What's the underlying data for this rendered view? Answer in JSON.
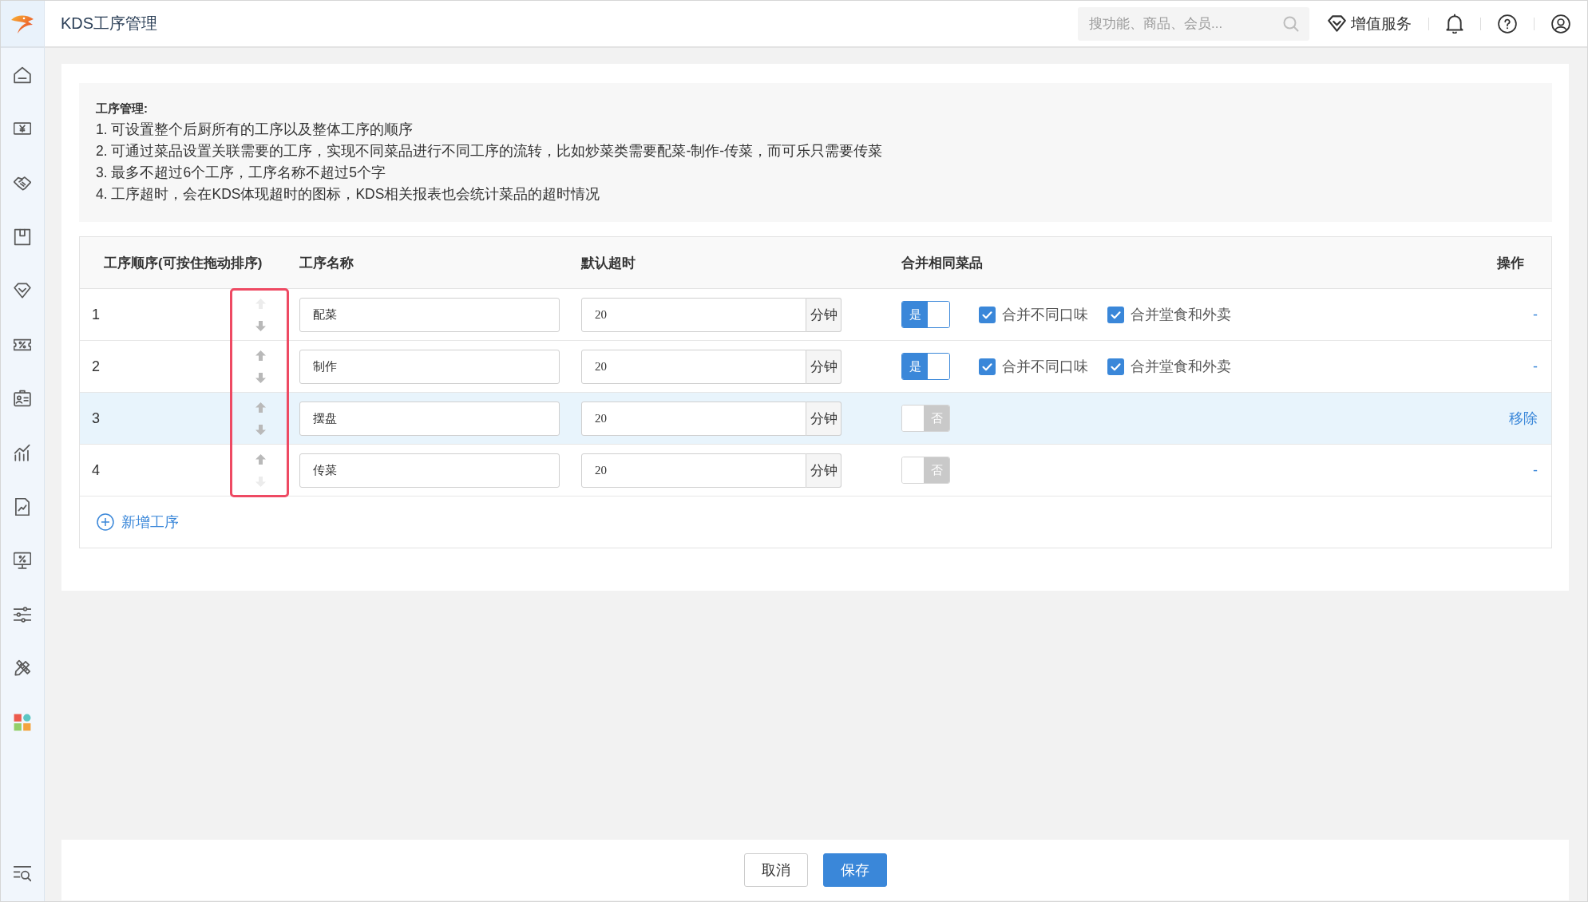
{
  "app": {
    "title": "KDS工序管理"
  },
  "header": {
    "search": {
      "placeholder": "搜功能、商品、会员..."
    },
    "services_label": "增值服务"
  },
  "notes": {
    "title": "工序管理:",
    "items": [
      "1. 可设置整个后厨所有的工序以及整体工序的顺序",
      "2. 可通过菜品设置关联需要的工序，实现不同菜品进行不同工序的流转，比如炒菜类需要配菜-制作-传菜，而可乐只需要传菜",
      "3. 最多不超过6个工序，工序名称不超过5个字",
      "4. 工序超时，会在KDS体现超时的图标，KDS相关报表也会统计菜品的超时情况"
    ]
  },
  "table": {
    "columns": [
      "工序顺序(可按住拖动排序)",
      "工序名称",
      "默认超时",
      "合并相同菜品",
      "操作"
    ],
    "rows": [
      {
        "order": "1",
        "up_disabled": true,
        "down_disabled": false,
        "name": "配菜",
        "timeout": "20",
        "timeout_unit": "分钟",
        "merge": {
          "on": true,
          "label": "是"
        },
        "options": [
          {
            "label": "合并不同口味",
            "checked": true
          },
          {
            "label": "合并堂食和外卖",
            "checked": true
          }
        ],
        "action": "-",
        "selected": false
      },
      {
        "order": "2",
        "up_disabled": false,
        "down_disabled": false,
        "name": "制作",
        "timeout": "20",
        "timeout_unit": "分钟",
        "merge": {
          "on": true,
          "label": "是"
        },
        "options": [
          {
            "label": "合并不同口味",
            "checked": true
          },
          {
            "label": "合并堂食和外卖",
            "checked": true
          }
        ],
        "action": "-",
        "selected": false
      },
      {
        "order": "3",
        "up_disabled": false,
        "down_disabled": false,
        "name": "摆盘",
        "timeout": "20",
        "timeout_unit": "分钟",
        "merge": {
          "on": false,
          "label": "否"
        },
        "action": "移除",
        "selected": true
      },
      {
        "order": "4",
        "up_disabled": false,
        "down_disabled": true,
        "name": "传菜",
        "timeout": "20",
        "timeout_unit": "分钟",
        "merge": {
          "on": false,
          "label": "否"
        },
        "action": "-",
        "selected": false
      }
    ],
    "add_label": "新增工序"
  },
  "footer": {
    "buttons": [
      {
        "label": "取消",
        "kind": "cancel"
      },
      {
        "label": "保存",
        "kind": "save"
      }
    ]
  }
}
